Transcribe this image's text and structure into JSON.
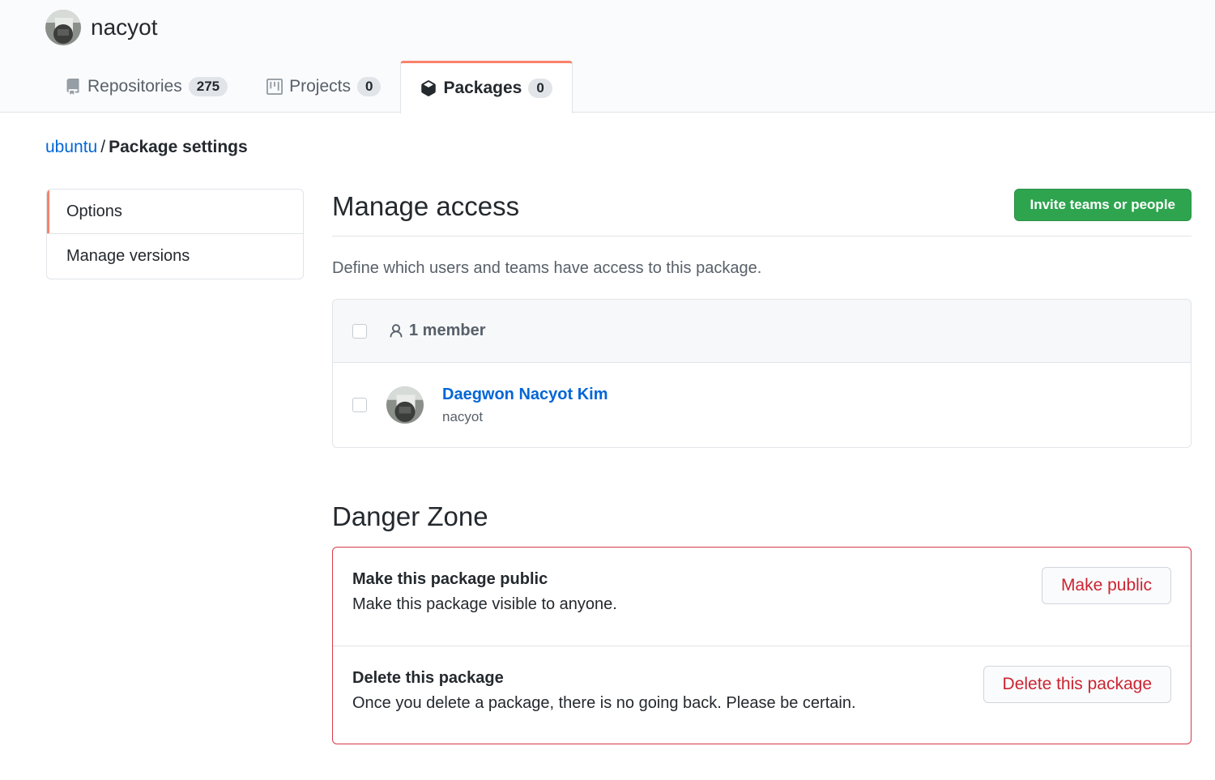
{
  "org": {
    "name": "nacyot",
    "avatar_icon": "avatar-photo"
  },
  "tabs": [
    {
      "label": "Repositories",
      "count": "275",
      "icon": "repo-icon",
      "selected": false
    },
    {
      "label": "Projects",
      "count": "0",
      "icon": "project-icon",
      "selected": false
    },
    {
      "label": "Packages",
      "count": "0",
      "icon": "package-icon",
      "selected": true
    }
  ],
  "breadcrumb": {
    "parent": "ubuntu",
    "separator": "/",
    "current": "Package settings"
  },
  "sidemenu": {
    "items": [
      {
        "label": "Options",
        "selected": true
      },
      {
        "label": "Manage versions",
        "selected": false
      }
    ]
  },
  "manage_access": {
    "title": "Manage access",
    "invite_label": "Invite teams or people",
    "description": "Define which users and teams have access to this package.",
    "member_count": "1 member",
    "members": [
      {
        "name": "Daegwon Nacyot Kim",
        "login": "nacyot"
      }
    ]
  },
  "danger_zone": {
    "title": "Danger Zone",
    "rows": [
      {
        "title": "Make this package public",
        "description": "Make this package visible to anyone.",
        "button": "Make public"
      },
      {
        "title": "Delete this package",
        "description": "Once you delete a package, there is no going back. Please be certain.",
        "button": "Delete this package"
      }
    ]
  },
  "colors": {
    "accent_tab": "#f9826c",
    "primary_button": "#2ea44f",
    "link": "#0366d6",
    "danger": "#d73a49",
    "danger_text": "#cb2431"
  }
}
